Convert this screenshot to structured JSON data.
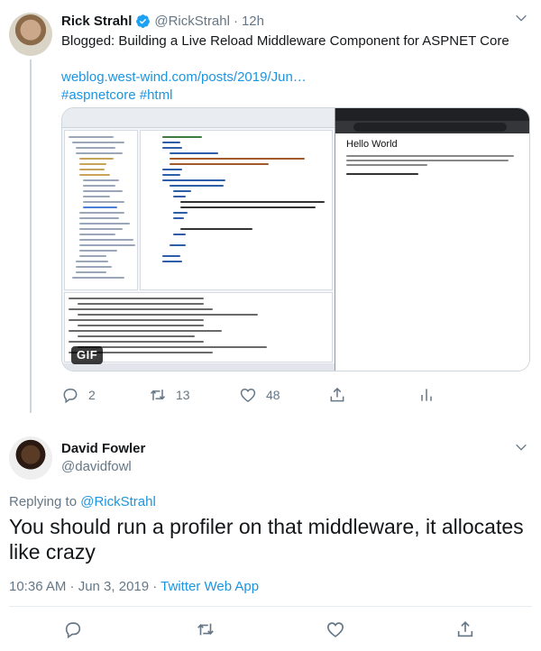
{
  "tweet1": {
    "author_name": "Rick Strahl",
    "author_handle": "@RickStrahl",
    "time": "12h",
    "text": "Blogged: Building a Live Reload Middleware Component for ASPNET Core",
    "link": "weblog.west-wind.com/posts/2019/Jun…",
    "hashtags": "#aspnetcore #html",
    "media": {
      "badge": "GIF",
      "browser_heading": "Hello World"
    },
    "actions": {
      "reply_count": "2",
      "retweet_count": "13",
      "like_count": "48"
    }
  },
  "tweet2": {
    "author_name": "David Fowler",
    "author_handle": "@davidfowl",
    "replying_prefix": "Replying to",
    "replying_to": "@RickStrahl",
    "text": "You should run a profiler on that middleware, it allocates like crazy",
    "timestamp": "10:36 AM · Jun 3, 2019 · ",
    "source": "Twitter Web App"
  },
  "icons": {
    "verified": "verified-badge-icon",
    "caret": "chevron-down-icon",
    "reply": "reply-icon",
    "retweet": "retweet-icon",
    "like": "heart-icon",
    "share": "share-icon",
    "analytics": "analytics-icon"
  },
  "colors": {
    "link": "#1b95e0",
    "secondary_text": "#657786",
    "divider": "#e6ecf0",
    "thread_line": "#ccd6dd"
  }
}
